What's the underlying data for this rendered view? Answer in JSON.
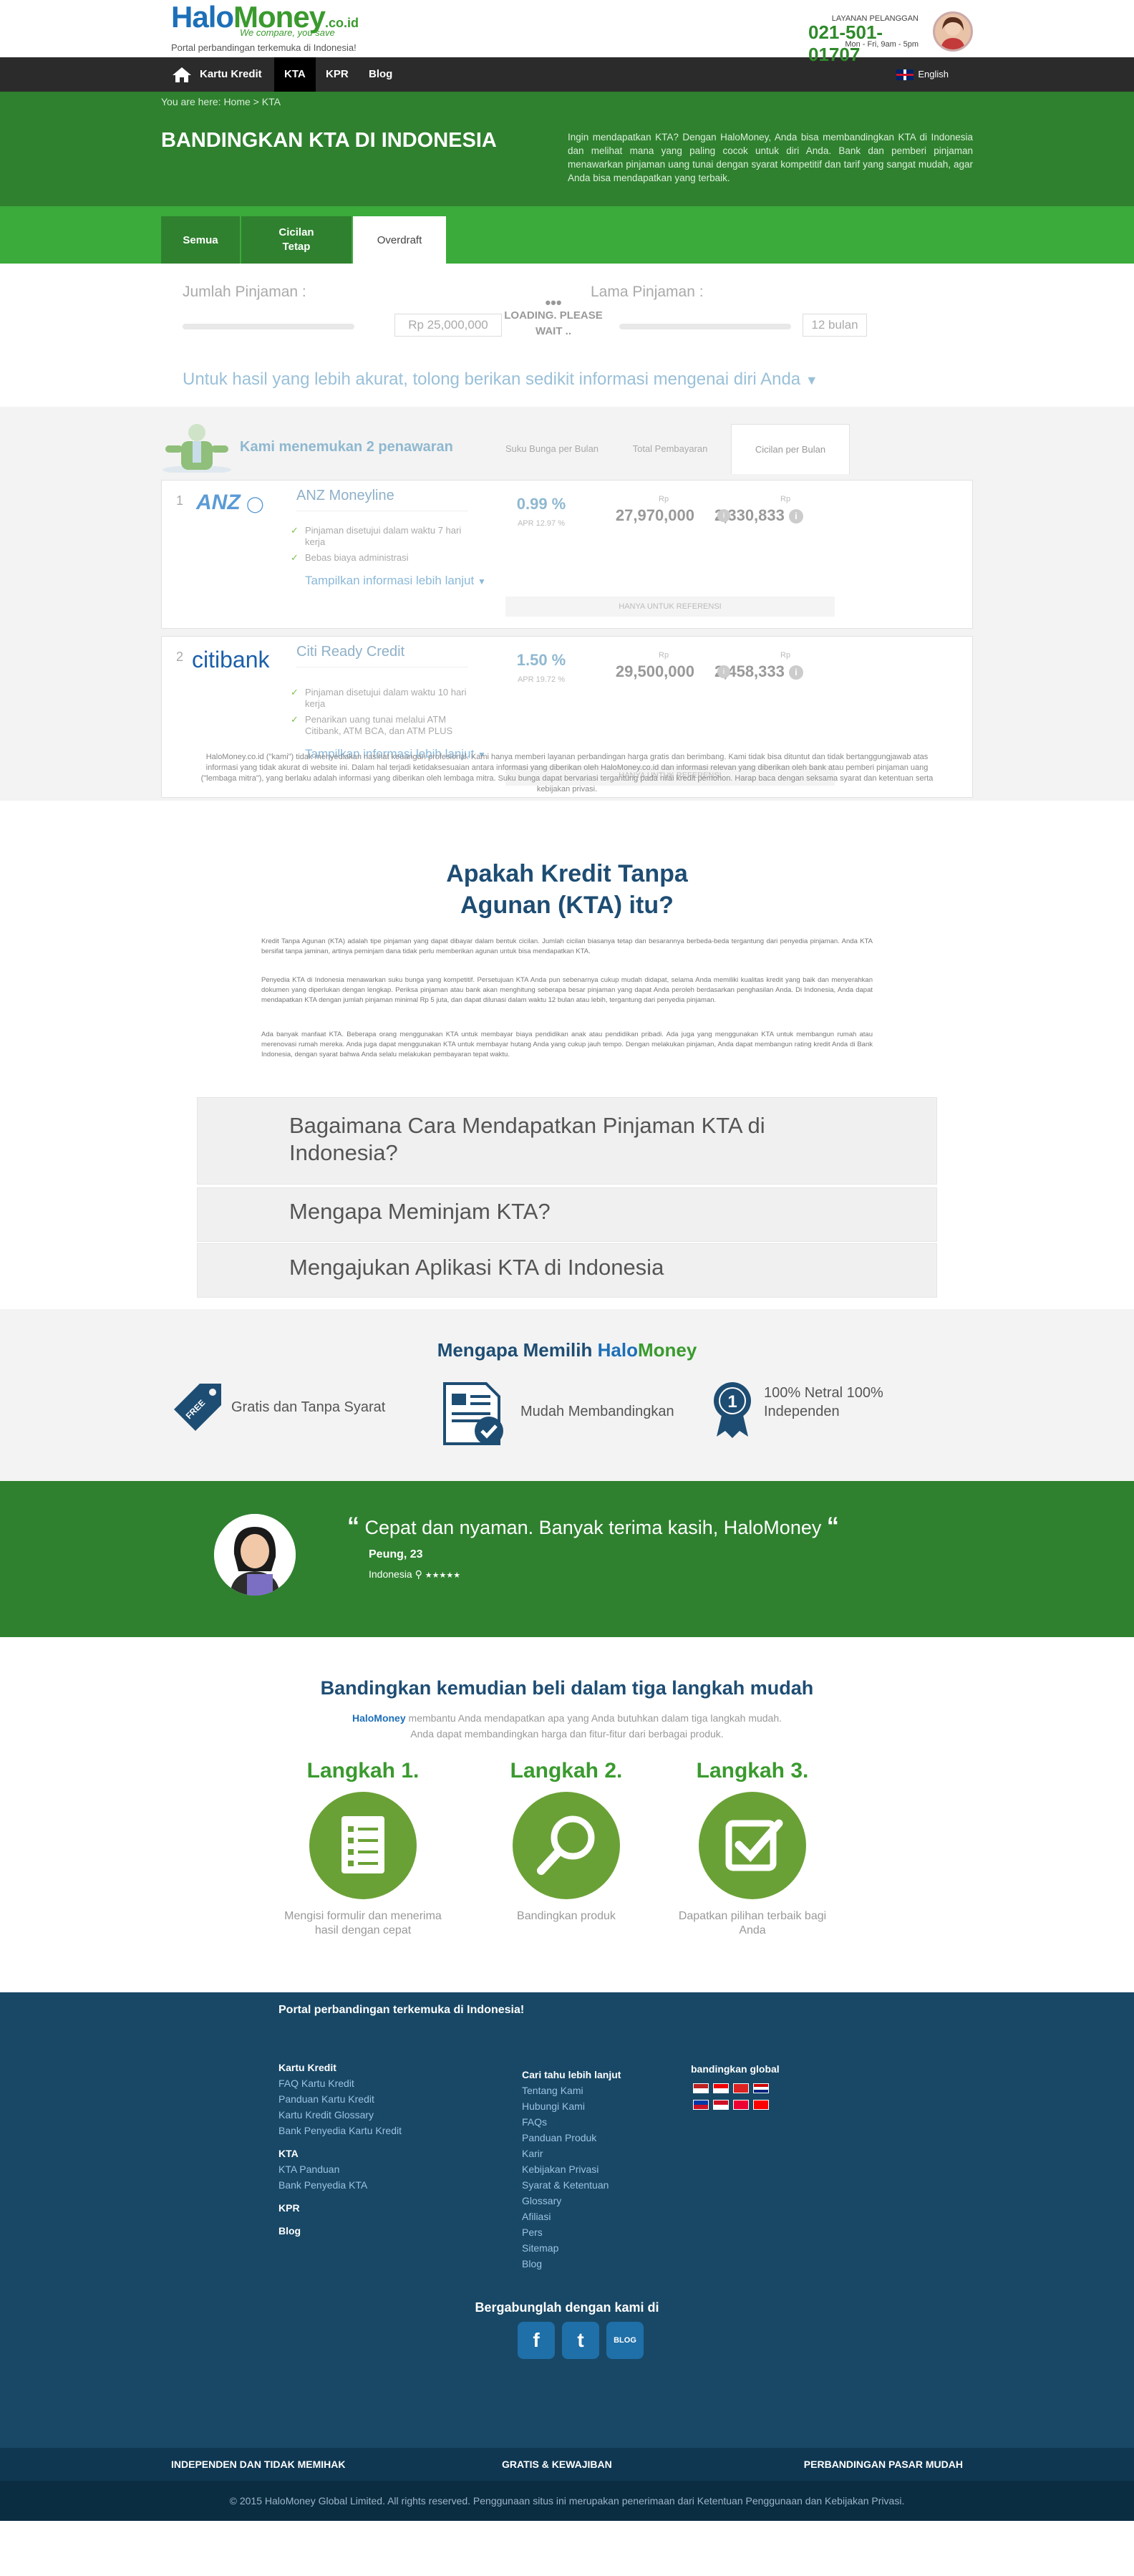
{
  "header": {
    "logo_halo": "Halo",
    "logo_money": "Money",
    "logo_tld": ".co.id",
    "slogan": "We compare, you save",
    "tagline": "Portal perbandingan terkemuka di Indonesia!",
    "cs_label": "LAYANAN PELANGGAN",
    "cs_phone": "021-501-01707",
    "cs_hours": "Mon - Fri, 9am - 5pm"
  },
  "nav": {
    "items": [
      "Kartu Kredit",
      "KTA",
      "KPR",
      "Blog"
    ],
    "active": "KTA",
    "language": "English"
  },
  "hero": {
    "breadcrumb": "You are here: Home >  KTA",
    "title": "BANDINGKAN KTA DI INDONESIA",
    "description": "Ingin mendapatkan KTA? Dengan HaloMoney, Anda bisa membandingkan KTA di Indonesia dan melihat mana yang paling cocok untuk diri Anda. Bank dan pemberi pinjaman menawarkan pinjaman uang tunai dengan syarat kompetitif dan tarif yang sangat mudah, agar Anda bisa mendapatkan yang terbaik."
  },
  "tabs": [
    "Semua",
    "Cicilan Tetap",
    "Overdraft"
  ],
  "form": {
    "loan_label": "Jumlah Pinjaman :",
    "loan_value": "Rp 25,000,000",
    "term_label": "Lama Pinjaman :",
    "term_value": "12 bulan",
    "loading": "LOADING. PLEASE WAIT ..",
    "info_prompt": "Untuk hasil yang lebih akurat, tolong berikan sedikit informasi mengenai diri Anda"
  },
  "results": {
    "found": "Kami menemukan 2 penawaran",
    "sort_headers": [
      "Suku Bunga per Bulan",
      "Total Pembayaran",
      "Cicilan per Bulan"
    ],
    "offers": [
      {
        "rank": "1",
        "bank": "ANZ",
        "name": "ANZ Moneyline",
        "features": [
          "Pinjaman disetujui dalam waktu 7 hari kerja",
          "Bebas biaya administrasi"
        ],
        "more": "Tampilkan informasi lebih lanjut",
        "rate": "0.99 %",
        "apr": "APR 12.97 %",
        "currency": "Rp",
        "total": "27,970,000",
        "monthly": "2,330,833",
        "reference": "HANYA UNTUK REFERENSI"
      },
      {
        "rank": "2",
        "bank": "citibank",
        "name": "Citi Ready Credit",
        "features": [
          "Pinjaman disetujui dalam waktu 10 hari kerja",
          "Penarikan uang tunai melalui ATM Citibank, ATM BCA, dan ATM PLUS"
        ],
        "more": "Tampilkan informasi lebih lanjut",
        "rate": "1.50 %",
        "apr": "APR 19.72 %",
        "currency": "Rp",
        "total": "29,500,000",
        "monthly": "2,458,333",
        "reference": "HANYA UNTUK REFERENSI"
      }
    ],
    "disclaimer": "HaloMoney.co.id (\"kami\") tidak menyediakan nasihat keuangan profesional. Kami hanya memberi layanan perbandingan harga gratis dan berimbang. Kami tidak bisa dituntut dan tidak bertanggungjawab atas informasi yang tidak akurat di website ini. Dalam hal terjadi ketidaksesuaian antara informasi yang diberikan oleh HaloMoney.co.id dan informasi relevan yang diberikan oleh bank atau pemberi pinjaman uang (\"lembaga mitra\"), yang berlaku adalah informasi yang diberikan oleh lembaga mitra. Suku bunga dapat bervariasi tergantung pada nilai kredit pemohon. Harap baca dengan seksama syarat dan ketentuan serta kebijakan privasi."
  },
  "what": {
    "title": "Apakah Kredit Tanpa Agunan (KTA) itu?",
    "p1": "Kredit Tanpa Agunan (KTA) adalah tipe pinjaman yang dapat dibayar dalam bentuk cicilan. Jumlah cicilan biasanya tetap dan besarannya berbeda-beda tergantung dari penyedia pinjaman. Anda KTA bersifat tanpa jaminan, artinya peminjam dana tidak perlu memberikan agunan untuk bisa mendapatkan KTA.",
    "p2": "Penyedia KTA di Indonesia menawarkan suku bunga yang kompetitif. Persetujuan KTA Anda pun sebenarnya cukup mudah didapat, selama Anda memiliki kualitas kredit yang baik dan menyerahkan dokumen yang diperlukan dengan lengkap. Periksa pinjaman atau bank akan menghitung seberapa besar pinjaman yang dapat Anda peroleh berdasarkan penghasilan Anda. Di Indonesia, Anda dapat mendapatkan KTA dengan jumlah pinjaman minimal Rp 5 juta, dan dapat dilunasi dalam waktu 12 bulan atau lebih, tergantung dari penyedia pinjaman.",
    "p3": "Ada banyak manfaat KTA. Beberapa orang menggunakan KTA untuk membayar biaya pendidikan anak atau pendidikan pribadi. Ada juga yang menggunakan KTA untuk membangun rumah atau merenovasi rumah mereka. Anda juga dapat menggunakan KTA untuk membayar hutang Anda yang cukup jauh tempo. Dengan melakukan pinjaman, Anda dapat membangun rating kredit Anda di Bank Indonesia, dengan syarat bahwa Anda selalu melakukan pembayaran tepat waktu.",
    "accordions": [
      "Bagaimana Cara Mendapatkan Pinjaman KTA di Indonesia?",
      "Mengapa Meminjam KTA?",
      "Mengajukan Aplikasi KTA di Indonesia"
    ]
  },
  "why": {
    "title_prefix": "Mengapa Memilih ",
    "title_halo": "Halo",
    "title_money": "Money",
    "items": [
      "Gratis dan Tanpa Syarat",
      "Mudah Membandingkan",
      "100% Netral 100% Independen"
    ],
    "free_badge": "FREE",
    "medal_number": "1"
  },
  "testimonial": {
    "quote": "Cepat dan nyaman. Banyak terima kasih, HaloMoney",
    "author": "Peung, 23",
    "location": "Indonesia",
    "stars": "★★★★★"
  },
  "steps": {
    "title": "Bandingkan kemudian beli dalam tiga langkah mudah",
    "brand": "HaloMoney",
    "text": " membantu Anda mendapatkan apa yang Anda butuhkan dalam tiga langkah mudah. Anda dapat membandingkan harga dan fitur-fitur dari berbagai produk.",
    "items": [
      {
        "title": "Langkah 1.",
        "desc": "Mengisi formulir dan menerima hasil dengan cepat"
      },
      {
        "title": "Langkah 2.",
        "desc": "Bandingkan produk"
      },
      {
        "title": "Langkah 3.",
        "desc": "Dapatkan pilihan terbaik bagi Anda"
      }
    ]
  },
  "footer": {
    "top": "Portal perbandingan terkemuka di Indonesia!",
    "col1": {
      "h1": "Kartu Kredit",
      "l1": [
        "FAQ Kartu Kredit",
        "Panduan Kartu Kredit",
        "Kartu Kredit Glossary",
        "Bank Penyedia Kartu Kredit"
      ],
      "h2": "KTA",
      "l2": [
        "KTA Panduan",
        "Bank Penyedia KTA"
      ],
      "h3": "KPR",
      "h4": "Blog"
    },
    "col2": {
      "h": "Cari tahu lebih lanjut",
      "links": [
        "Tentang Kami",
        "Hubungi Kami",
        "FAQs",
        "Panduan Produk",
        "Karir",
        "Kebijakan Privasi",
        "Syarat & Ketentuan",
        "Glossary",
        "Afiliasi",
        "Pers",
        "Sitemap",
        "Blog"
      ]
    },
    "col3": {
      "h": "bandingkan global"
    },
    "social_title": "Bergabunglah dengan kami di",
    "social": [
      "f",
      "t",
      "BLOG"
    ],
    "bar": [
      "INDEPENDEN DAN TIDAK MEMIHAK",
      "GRATIS & KEWAJIBAN",
      "PERBANDINGAN PASAR MUDAH"
    ],
    "copyright": "© 2015 HaloMoney Global Limited. All rights reserved. Penggunaan situs ini merupakan penerimaan dari Ketentuan Penggunaan dan Kebijakan Privasi."
  },
  "colors": {
    "dark_green": "#2f812f",
    "bright_green": "#3bab3b",
    "navy": "#184866",
    "nav_bg": "#2b2b2b"
  }
}
